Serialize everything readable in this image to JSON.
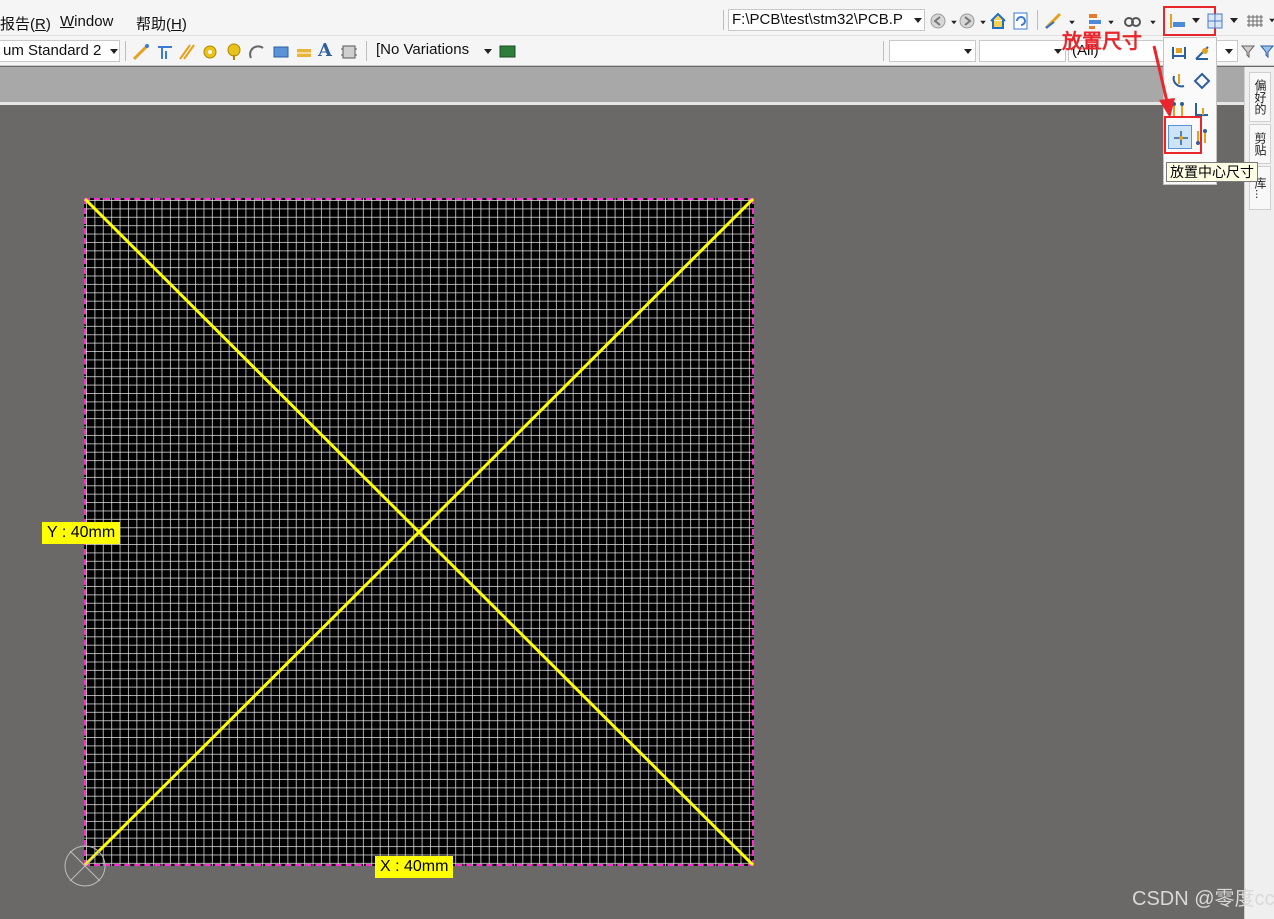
{
  "menubar": {
    "items": [
      {
        "label": "报告(",
        "accel": "R",
        "suffix": ")"
      },
      {
        "label": "",
        "accel": "W",
        "suffix": "indow"
      },
      {
        "label": "帮助(",
        "accel": "H",
        "suffix": ")"
      }
    ]
  },
  "toolbar1": {
    "path_combo": "F:\\PCB\\test\\stm32\\PCB.P",
    "icons": [
      "back-icon",
      "forward-icon",
      "home-icon",
      "refresh-icon",
      "interactive-routing-icon",
      "align-icon",
      "find-icon",
      "dimension-icon",
      "grid-layout-icon",
      "grid-icon"
    ]
  },
  "toolbar2": {
    "layer_combo": "um Standard 2",
    "variations_combo": "[No Variations",
    "filter_combo_3": "(All)"
  },
  "right_panel": {
    "tabs": [
      "偏好的",
      "剪贴",
      "库..."
    ]
  },
  "board": {
    "x_label": "X : 40mm",
    "y_label": "Y : 40mm",
    "width_mm": 40,
    "height_mm": 40
  },
  "dimension_menu": {
    "tooltip": "放置中心尺寸"
  },
  "annotation": {
    "text": "放置尺寸"
  },
  "watermark": "CSDN @零度cc",
  "colors": {
    "workspace": "#6b6967",
    "board": "#000000",
    "grid": "#e6e6e6",
    "outline": "#ff2bd5",
    "diagonal": "#ffff00",
    "label_bg": "#ffff00",
    "annotation": "#e8262b"
  }
}
